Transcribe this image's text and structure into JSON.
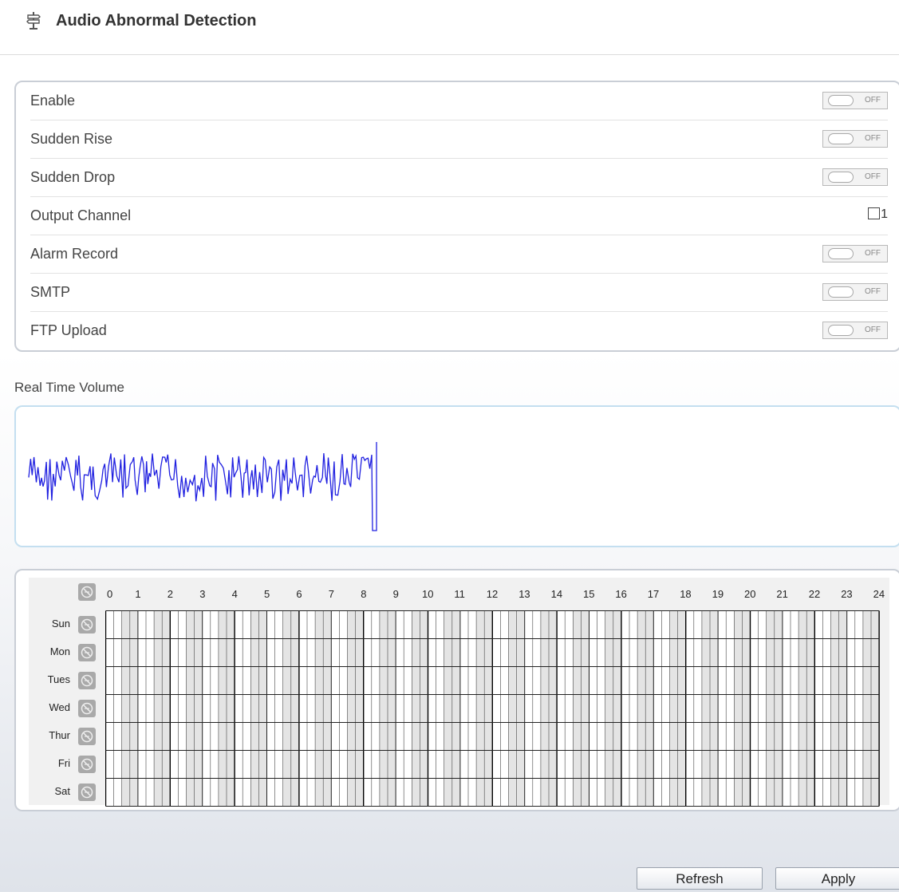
{
  "header": {
    "title": "Audio Abnormal Detection",
    "icon": "signpost-icon"
  },
  "settings": [
    {
      "label": "Enable",
      "control": "toggle",
      "state": "OFF"
    },
    {
      "label": "Sudden Rise",
      "control": "toggle",
      "state": "OFF"
    },
    {
      "label": "Sudden Drop",
      "control": "toggle",
      "state": "OFF"
    },
    {
      "label": "Output Channel",
      "control": "checkbox",
      "checked": false,
      "value": "1"
    },
    {
      "label": "Alarm Record",
      "control": "toggle",
      "state": "OFF"
    },
    {
      "label": "SMTP",
      "control": "toggle",
      "state": "OFF"
    },
    {
      "label": "FTP Upload",
      "control": "toggle",
      "state": "OFF"
    }
  ],
  "volume": {
    "label": "Real Time Volume",
    "line_color": "#2020e0"
  },
  "schedule": {
    "days": [
      "Sun",
      "Mon",
      "Tues",
      "Wed",
      "Thur",
      "Fri",
      "Sat"
    ],
    "hours": [
      "0",
      "1",
      "2",
      "3",
      "4",
      "5",
      "6",
      "7",
      "8",
      "9",
      "10",
      "11",
      "12",
      "13",
      "14",
      "15",
      "16",
      "17",
      "18",
      "19",
      "20",
      "21",
      "22",
      "23",
      "24"
    ],
    "selected_slots": []
  },
  "buttons": {
    "refresh": "Refresh",
    "apply": "Apply"
  }
}
